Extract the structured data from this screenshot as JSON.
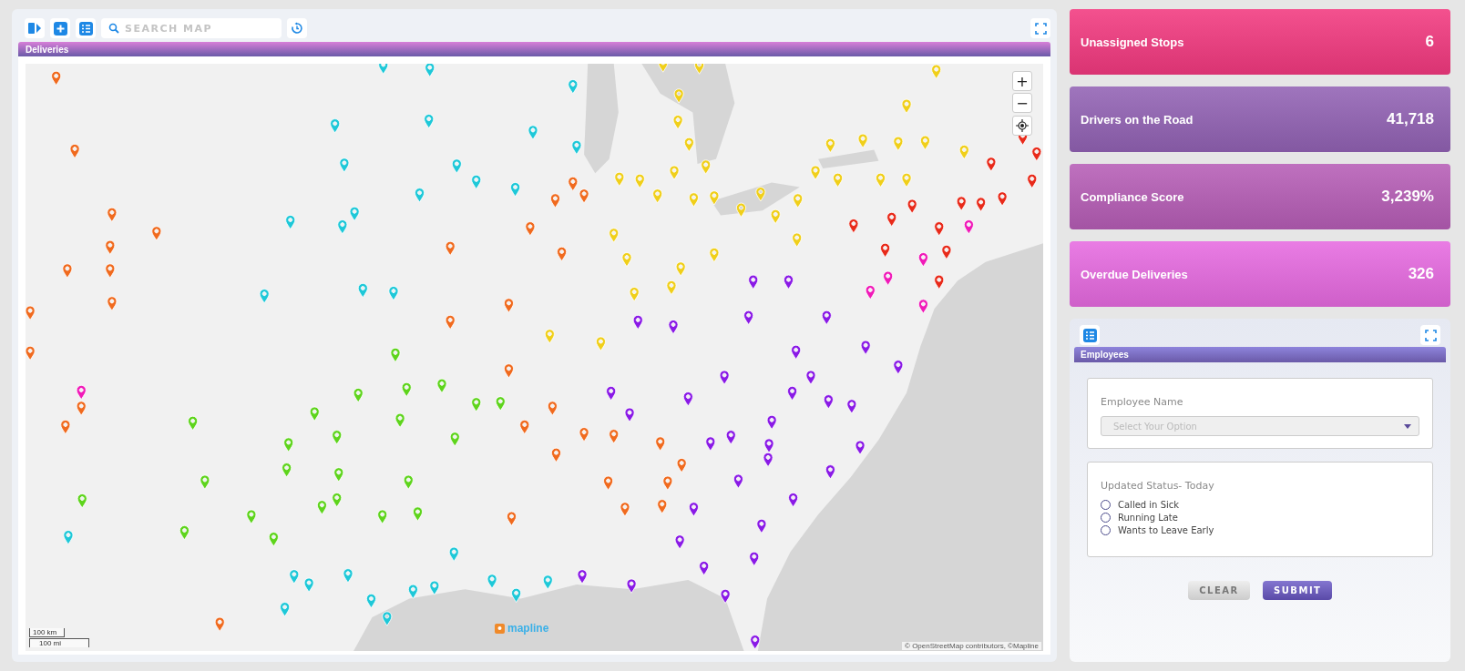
{
  "toolbar": {
    "search": {
      "placeholder": "SEARCH MAP"
    }
  },
  "map_panel": {
    "title": "Deliveries",
    "zoom_in": "+",
    "zoom_out": "−",
    "scale_km": "100 km",
    "scale_mi": "100 mi",
    "logo": "mapline",
    "attribution": "© OpenStreetMap contributors, ©Mapline"
  },
  "stats": [
    {
      "label": "Unassigned Stops",
      "value": "6",
      "color": "#f2397f"
    },
    {
      "label": "Drivers on the Road",
      "value": "41,718",
      "color": "#9262b4"
    },
    {
      "label": "Compliance Score",
      "value": "3,239%",
      "color": "#b65db6"
    },
    {
      "label": "Overdue Deliveries",
      "value": "326",
      "color": "#e66ae0"
    }
  ],
  "employees": {
    "title": "Employees",
    "name_label": "Employee Name",
    "name_select": {
      "placeholder": "Select Your Option"
    },
    "status_label": "Updated Status- Today",
    "options": [
      {
        "label": "Called in Sick",
        "selected": false
      },
      {
        "label": "Running Late",
        "selected": false
      },
      {
        "label": "Wants to Leave Early",
        "selected": false
      }
    ],
    "buttons": [
      {
        "label": "CLEAR",
        "kind": "secondary"
      },
      {
        "label": "SUBMIT",
        "kind": "primary"
      }
    ]
  }
}
